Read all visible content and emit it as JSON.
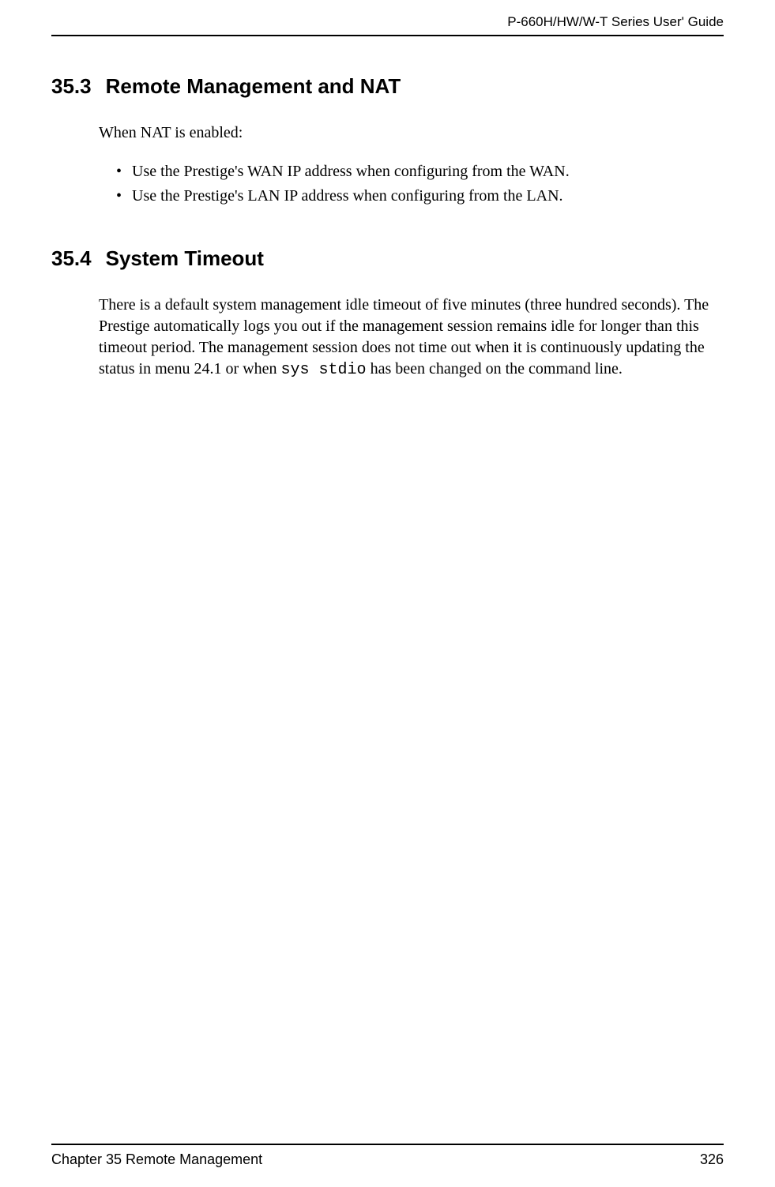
{
  "header": {
    "guide_title": "P-660H/HW/W-T Series User' Guide"
  },
  "sections": {
    "s1": {
      "number": "35.3",
      "title": "Remote Management and NAT",
      "intro": "When NAT is enabled:",
      "bullets": [
        "Use the Prestige's WAN IP address when configuring from the WAN.",
        "Use the Prestige's LAN IP address when configuring from the LAN."
      ]
    },
    "s2": {
      "number": "35.4",
      "title": "System Timeout",
      "para_pre": "There is a default system management idle timeout of five minutes (three hundred seconds). The Prestige automatically logs you out if the management session remains idle for longer than this timeout period. The management session does not time out when it is continuously updating the status in menu 24.1 or when ",
      "code": "sys stdio",
      "para_post": " has been changed on the command line."
    }
  },
  "footer": {
    "chapter": "Chapter 35 Remote Management",
    "page_number": "326"
  }
}
